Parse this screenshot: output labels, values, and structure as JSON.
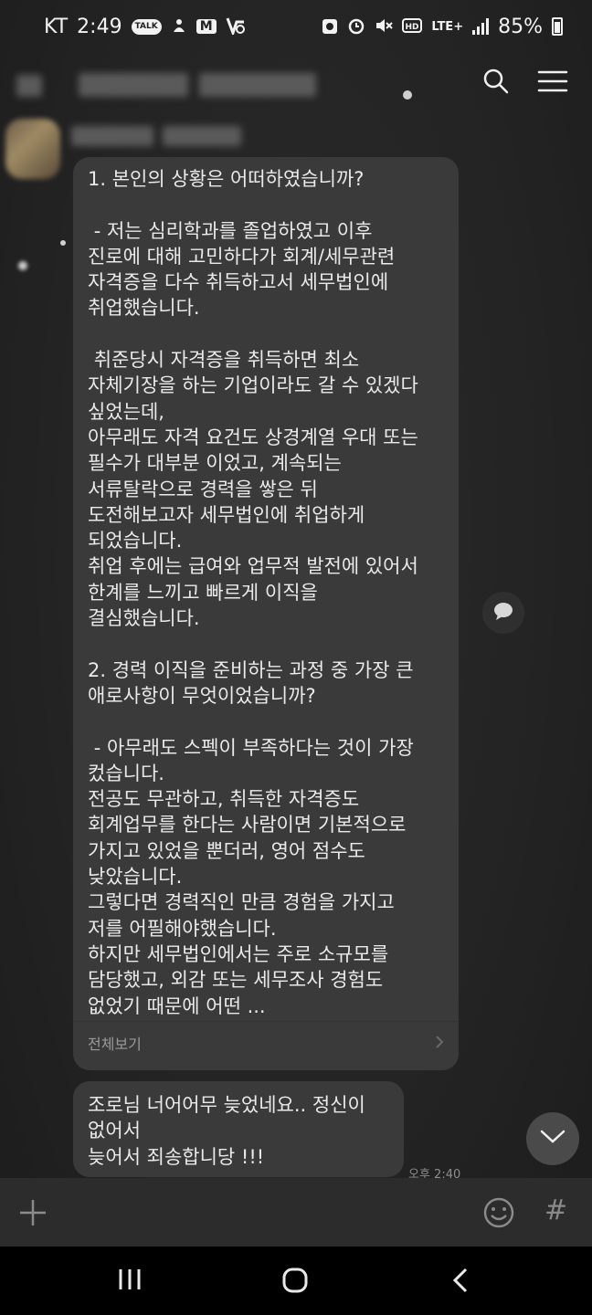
{
  "status_bar": {
    "carrier": "KT",
    "time": "2:49",
    "talk_badge": "TALK",
    "m_badge": "M",
    "network": "LTE+",
    "battery": "85%"
  },
  "messages": [
    {
      "text": "1. 본인의 상황은 어떠하였습니까?\n\n - 저는 심리학과를 졸업하였고 이후\n진로에 대해 고민하다가 회계/세무관련\n자격증을 다수 취득하고서 세무법인에\n취업했습니다.\n\n 취준당시 자격증을 취득하면 최소\n자체기장을 하는 기업이라도 갈 수 있겠다\n싶었는데,\n아무래도 자격 요건도 상경계열 우대 또는\n필수가 대부분 이었고, 계속되는\n서류탈락으로 경력을 쌓은 뒤\n도전해보고자 세무법인에 취업하게\n되었습니다.\n취업 후에는 급여와 업무적 발전에 있어서\n한계를 느끼고 빠르게 이직을\n결심했습니다.\n\n2. 경력 이직을 준비하는 과정 중 가장 큰\n애로사항이 무엇이었습니까?\n\n - 아무래도 스펙이 부족하다는 것이 가장\n컸습니다.\n전공도 무관하고, 취득한 자격증도\n회계업무를 한다는 사람이면 기본적으로\n가지고 있었을 뿐더러, 영어 점수도\n낮았습니다.\n그렇다면 경력직인 만큼 경험을 가지고\n저를 어필해야했습니다.\n하지만 세무법인에서는 주로 소규모를\n담당했고, 외감 또는 세무조사 경험도\n없었기 때문에 어떤 ...",
      "see_all": "전체보기"
    },
    {
      "text": "조로님 너어어무 늦었네요.. 정신이\n없어서\n늦어서 죄송합니당 !!!",
      "time": "오후 2:40"
    }
  ],
  "input_bar": {
    "hash": "#"
  }
}
